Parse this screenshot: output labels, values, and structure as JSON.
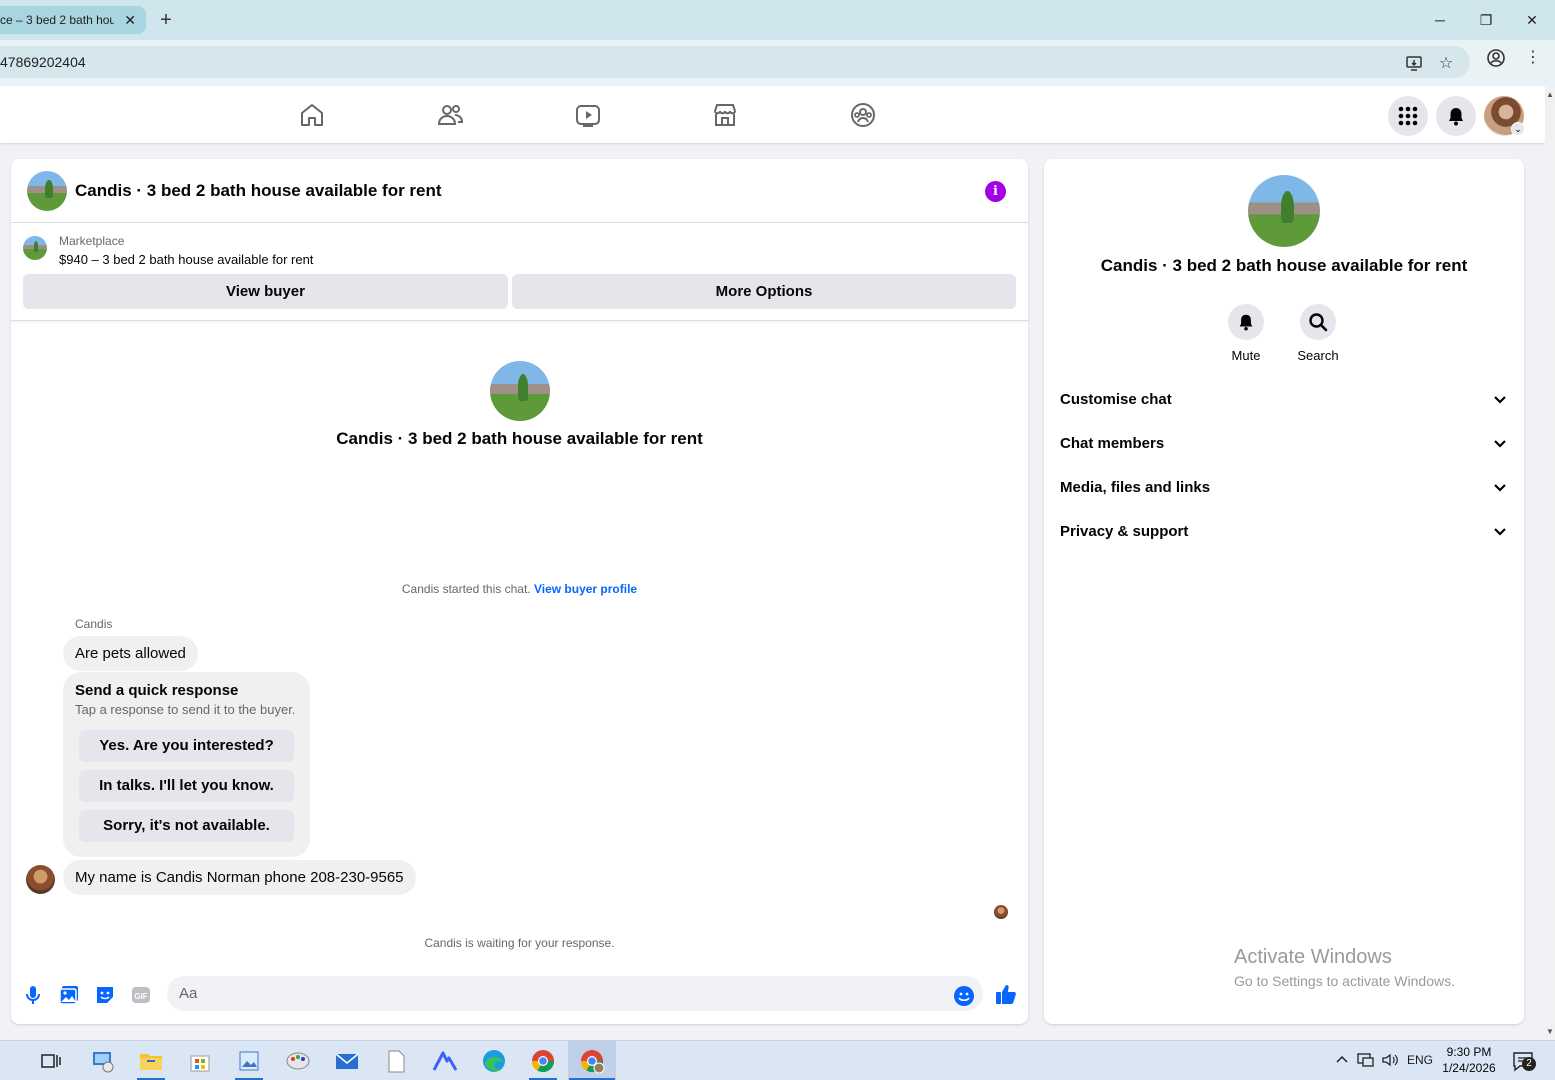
{
  "browser": {
    "tab_title": "ce – 3 bed 2 bath hou",
    "tab_close": "✕",
    "new_tab": "+",
    "url": "47869202404",
    "window_controls": {
      "minimize": "─",
      "restore": "❐",
      "close": "✕"
    }
  },
  "fb_nav": {
    "items": [
      "home-icon",
      "friends-icon",
      "watch-icon",
      "marketplace-icon",
      "groups-icon"
    ]
  },
  "chat": {
    "title": "Candis · 3 bed 2 bath house available for rent",
    "marketplace_label": "Marketplace",
    "listing": "$940 – 3 bed 2 bath house available for rent",
    "view_buyer": "View buyer",
    "more_options": "More Options",
    "center_name": "Candis · 3 bed 2 bath house available for rent",
    "started_text": "Candis started this chat.",
    "view_buyer_profile": "View buyer profile",
    "sender_name": "Candis",
    "message_1": "Are pets allowed",
    "quick_title": "Send a quick response",
    "quick_sub": "Tap a response to send it to the buyer.",
    "quick_responses": [
      "Yes. Are you interested?",
      "In talks. I'll let you know.",
      "Sorry, it's not available."
    ],
    "message_2": "My name is Candis Norman phone 208-230-9565",
    "waiting": "Candis is waiting for your response.",
    "input_placeholder": "Aa"
  },
  "info_panel": {
    "name": "Candis · 3 bed 2 bath house available for rent",
    "mute": "Mute",
    "search": "Search",
    "rows": [
      "Customise chat",
      "Chat members",
      "Media, files and links",
      "Privacy & support"
    ]
  },
  "watermark": {
    "line1": "Activate Windows",
    "line2": "Go to Settings to activate Windows."
  },
  "taskbar": {
    "lang": "ENG",
    "time": "9:30 PM",
    "date": "1/24/2026",
    "notif_count": "2"
  },
  "colors": {
    "fb_blue": "#0866ff",
    "info_purple": "#a400e6"
  }
}
